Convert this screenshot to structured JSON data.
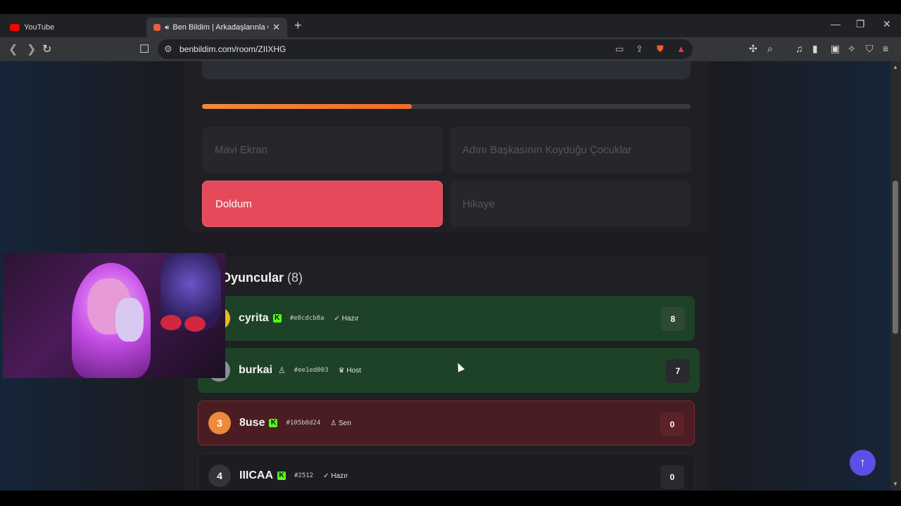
{
  "tabs": [
    {
      "title": "YouTube",
      "active": false
    },
    {
      "title": "Ben Bildim | Arkadaşlarınla Online",
      "active": true
    }
  ],
  "toolbar": {
    "url": "benbildim.com/room/ZIIXHG"
  },
  "question": {
    "progress_percent": 43,
    "options": [
      {
        "label": "Mavi Ekran",
        "selected": false
      },
      {
        "label": "Adını Başkasının Koyduğu Çocuklar",
        "selected": false
      },
      {
        "label": "Doldum",
        "selected": true
      },
      {
        "label": "Hikaye",
        "selected": false
      }
    ]
  },
  "players": {
    "title": "Oyuncular",
    "count": "(8)",
    "list": [
      {
        "rank": "1",
        "name": "cyrita",
        "icon": "kick-icon",
        "hash": "#e8cdcb8a",
        "badge": "Hazır",
        "score": "8",
        "style": "green"
      },
      {
        "rank": "2",
        "name": "burkai",
        "icon": "user-icon",
        "hash": "#ee1ed003",
        "badge": "Host",
        "score": "7",
        "style": "green"
      },
      {
        "rank": "3",
        "name": "8use",
        "icon": "kick-icon",
        "hash": "#105b8d24",
        "badge": "Sen",
        "score": "0",
        "style": "red"
      },
      {
        "rank": "4",
        "name": "IIICAA",
        "icon": "kick-icon",
        "hash": "#2512",
        "badge": "Hazır",
        "score": "0",
        "style": "dark"
      }
    ]
  },
  "colors": {
    "accent_orange": "#ef6c2a",
    "selected_red": "#e5495a",
    "row_green": "#1d4227",
    "row_red": "#4a1d22",
    "fab_blue": "#5c4fe8"
  }
}
